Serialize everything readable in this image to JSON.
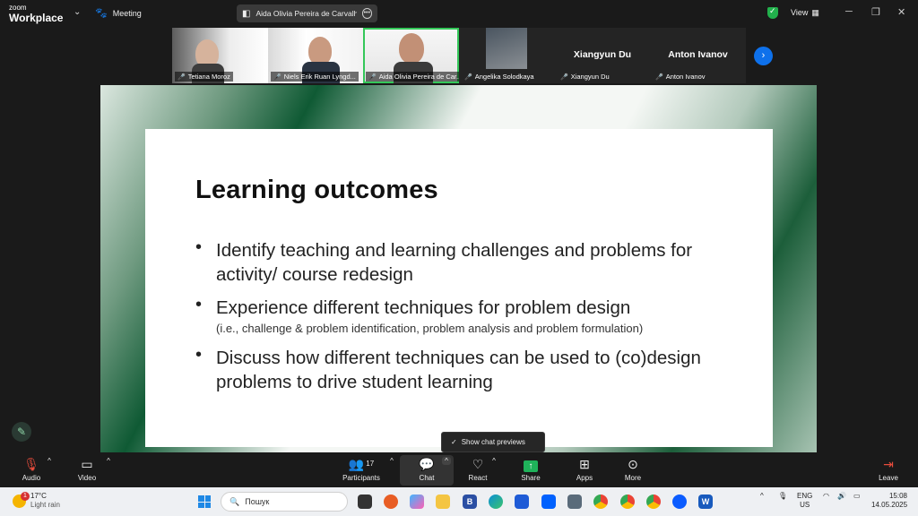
{
  "titlebar": {
    "brand_line1": "zoom",
    "brand_line2": "Workplace",
    "meeting_label": "Meeting",
    "active_speaker": "Aida Olivia Pereira de Carvalho C",
    "view_label": "View"
  },
  "participants": [
    {
      "label": "Tetiana Moroz",
      "big_name": ""
    },
    {
      "label": "Niels Erik Ruan Lyngd...",
      "big_name": ""
    },
    {
      "label": "Aida Olivia Pereira de Car...",
      "big_name": ""
    },
    {
      "label": "Angelika Solodkaya",
      "big_name": ""
    },
    {
      "label": "Xiangyun Du",
      "big_name": "Xiangyun Du"
    },
    {
      "label": "Anton Ivanov",
      "big_name": "Anton Ivanov"
    }
  ],
  "slide": {
    "title": "Learning outcomes",
    "bullets": [
      {
        "main": "Identify teaching and learning challenges and problems for activity/ course redesign",
        "sub": ""
      },
      {
        "main": "Experience different techniques for problem design",
        "sub": "(i.e., challenge & problem identification,  problem analysis and problem formulation)"
      },
      {
        "main": "Discuss how different techniques can be used to (co)design problems to drive student learning",
        "sub": ""
      }
    ]
  },
  "toast": {
    "text": "Show chat previews"
  },
  "toolbar": {
    "audio": "Audio",
    "video": "Video",
    "participants": "Participants",
    "participants_count": "17",
    "chat": "Chat",
    "react": "React",
    "share": "Share",
    "apps": "Apps",
    "more": "More",
    "leave": "Leave"
  },
  "taskbar": {
    "weather_temp": "17°C",
    "weather_cond": "Light rain",
    "weather_badge": "1",
    "search_placeholder": "Пошук",
    "lang_line1": "ENG",
    "lang_line2": "US",
    "time": "15:08",
    "date": "14.05.2025"
  },
  "colors": {
    "accent_green": "#34c759",
    "share_green": "#1fb25a",
    "zoom_blue": "#0e71eb",
    "slide_green": "#0f5a34",
    "leave_red": "#e74c3c"
  }
}
